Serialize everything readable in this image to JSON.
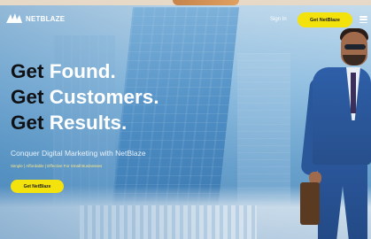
{
  "brand": {
    "name": "NETBLAZE",
    "logo_icon": "netblaze-logo-icon"
  },
  "nav": {
    "signin_label": "Sign In",
    "cta_label": "Get NetBlaze",
    "menu_icon": "hamburger-menu-icon"
  },
  "hero": {
    "headline": [
      {
        "dark": "Get",
        "white": "Found."
      },
      {
        "dark": "Get",
        "white": "Customers."
      },
      {
        "dark": "Get",
        "white": "Results."
      }
    ],
    "subhead": "Conquer Digital Marketing with NetBlaze",
    "tagline": "Simple | Affordable | Effective For Small Businesses",
    "cta_label": "Get NetBlaze"
  },
  "colors": {
    "accent_yellow": "#f4e20d",
    "headline_dark": "#0f1115",
    "headline_white": "#ffffff",
    "background_blue": "#7fb3d8"
  }
}
